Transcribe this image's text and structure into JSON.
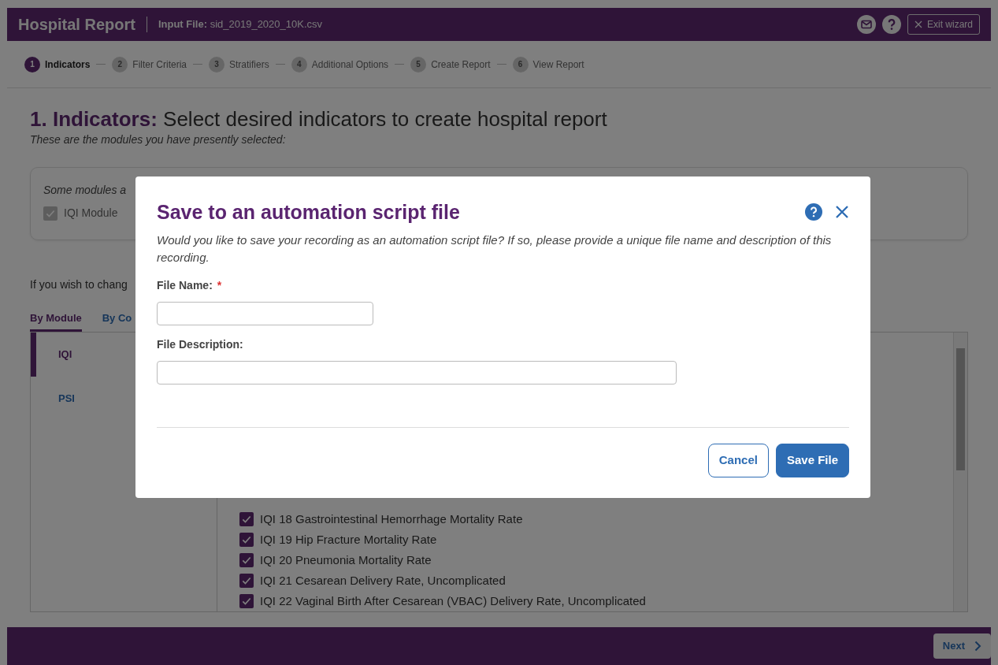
{
  "header": {
    "title": "Hospital Report",
    "input_file_label": "Input File:",
    "input_file": "sid_2019_2020_10K.csv",
    "exit_label": "Exit wizard"
  },
  "steps": [
    {
      "number": "1",
      "label": "Indicators",
      "selected": true
    },
    {
      "number": "2",
      "label": "Filter Criteria",
      "selected": false
    },
    {
      "number": "3",
      "label": "Stratifiers",
      "selected": false
    },
    {
      "number": "4",
      "label": "Additional Options",
      "selected": false
    },
    {
      "number": "5",
      "label": "Create Report",
      "selected": false
    },
    {
      "number": "6",
      "label": "View Report",
      "selected": false
    }
  ],
  "page": {
    "heading": "**1. Indicators:** Select desired indicators to create hospital report",
    "subtitle": "These are the modules you have presently selected:"
  },
  "modules_card": {
    "note": "Some modules a",
    "items": [
      {
        "label": "IQI Module",
        "checked": true,
        "disabled": true
      }
    ]
  },
  "instruction": "If you wish to chang",
  "view_tabs": [
    {
      "label": "By Module",
      "selected": true
    },
    {
      "label": "By Co",
      "selected": false
    }
  ],
  "module_list": [
    {
      "label": "IQI",
      "selected": true
    },
    {
      "label": "PSI",
      "selected": false
    }
  ],
  "indicators": [
    {
      "label": "IQI 18 Gastrointestinal Hemorrhage Mortality Rate",
      "checked": true
    },
    {
      "label": "IQI 19 Hip Fracture Mortality Rate",
      "checked": true
    },
    {
      "label": "IQI 20 Pneumonia Mortality Rate",
      "checked": true
    },
    {
      "label": "IQI 21 Cesarean Delivery Rate, Uncomplicated",
      "checked": true
    },
    {
      "label": "IQI 22 Vaginal Birth After Cesarean (VBAC) Delivery Rate, Uncomplicated",
      "checked": true
    }
  ],
  "footer": {
    "next_label": "Next"
  },
  "dialog": {
    "title": "Save to an automation script file",
    "description": "Would you like to save your recording as an automation script file? If so, please provide a unique file name and description of this recording.",
    "fields": [
      {
        "label": "File Name:",
        "required_mark": "*"
      },
      {
        "label": "File Description:"
      }
    ],
    "buttons": [
      {
        "label": "Cancel",
        "kind": "secondary"
      },
      {
        "label": "Save File",
        "kind": "primary"
      }
    ]
  }
}
